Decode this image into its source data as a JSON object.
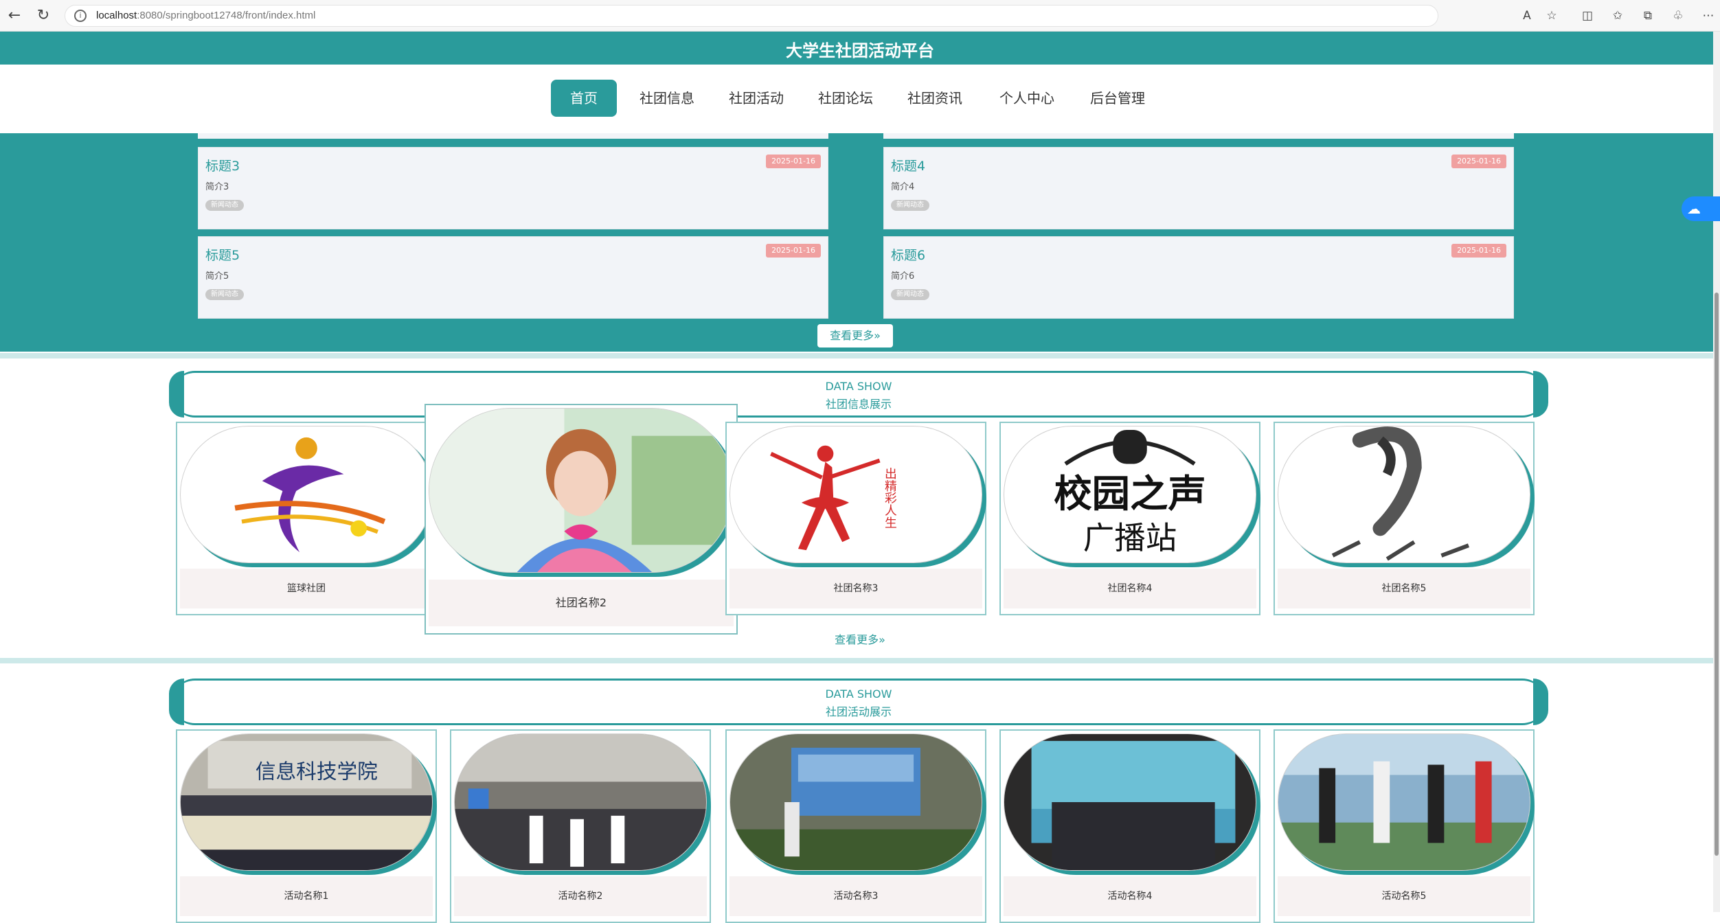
{
  "browser": {
    "url_host": "localhost",
    "url_path": ":8080/springboot12748/front/index.html"
  },
  "site": {
    "title": "大学生社团活动平台"
  },
  "nav": {
    "items": [
      "首页",
      "社团信息",
      "社团活动",
      "社团论坛",
      "社团资讯",
      "个人中心",
      "后台管理"
    ]
  },
  "news": {
    "cards": [
      {
        "title": "标题3",
        "intro": "简介3",
        "date": "2025-01-16",
        "tag": "新闻动态"
      },
      {
        "title": "标题4",
        "intro": "简介4",
        "date": "2025-01-16",
        "tag": "新闻动态"
      },
      {
        "title": "标题5",
        "intro": "简介5",
        "date": "2025-01-16",
        "tag": "新闻动态"
      },
      {
        "title": "标题6",
        "intro": "简介6",
        "date": "2025-01-16",
        "tag": "新闻动态"
      }
    ],
    "more_label": "查看更多»"
  },
  "clubs_section": {
    "en": "DATA SHOW",
    "cn": "社团信息展示",
    "items": [
      "篮球社团",
      "社团名称2",
      "社团名称3",
      "社团名称4",
      "社团名称5"
    ],
    "image_texts": {
      "club4_line1": "校园之声",
      "club4_line2": "广播站"
    },
    "more_label": "查看更多»"
  },
  "activities_section": {
    "en": "DATA SHOW",
    "cn": "社团活动展示",
    "items": [
      "活动名称1",
      "活动名称2",
      "活动名称3",
      "活动名称4",
      "活动名称5"
    ],
    "image_texts": {
      "act1_banner": "信息科技学院"
    }
  },
  "colors": {
    "brand": "#2a9b9b",
    "date_badge": "#f0a0a0"
  }
}
